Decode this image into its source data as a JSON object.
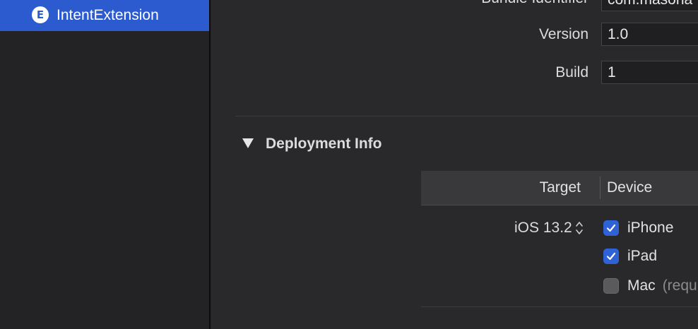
{
  "sidebar": {
    "selected_item": {
      "label": "IntentExtension",
      "icon": "extension-icon",
      "icon_letter": "E"
    }
  },
  "identity": {
    "bundle_identifier_label": "Bundle Identifier",
    "bundle_identifier_value": "com.masona",
    "version_label": "Version",
    "version_value": "1.0",
    "build_label": "Build",
    "build_value": "1"
  },
  "deployment": {
    "section_title": "Deployment Info",
    "columns": {
      "target": "Target",
      "device": "Device"
    },
    "target_value": "iOS 13.2",
    "devices": [
      {
        "label": "iPhone",
        "checked": true
      },
      {
        "label": "iPad",
        "checked": true
      },
      {
        "label": "Mac",
        "checked": false,
        "note": "(requ"
      }
    ]
  },
  "colors": {
    "accent": "#2c5bd0",
    "checkbox_checked": "#2e62d6"
  }
}
